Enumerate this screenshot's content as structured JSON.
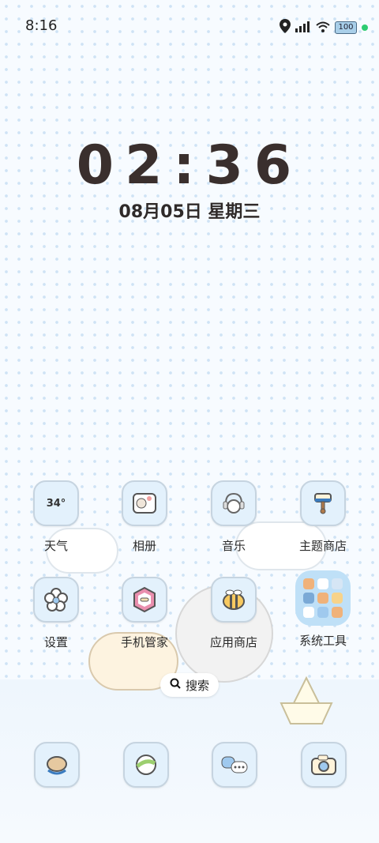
{
  "status_bar": {
    "time": "8:16",
    "battery": "100",
    "icons": [
      "location-icon",
      "signal-icon",
      "wifi-icon",
      "battery-icon",
      "privacy-dot"
    ]
  },
  "clock": {
    "time": "02:36",
    "date": "08月05日 星期三"
  },
  "apps_row1": [
    {
      "label": "天气",
      "icon_text": "34°",
      "icon": "weather-icon"
    },
    {
      "label": "相册",
      "icon": "gallery-icon"
    },
    {
      "label": "音乐",
      "icon": "music-icon"
    },
    {
      "label": "主题商店",
      "icon": "theme-store-icon"
    }
  ],
  "apps_row2": [
    {
      "label": "设置",
      "icon": "settings-icon"
    },
    {
      "label": "手机管家",
      "icon": "phone-manager-icon"
    },
    {
      "label": "应用商店",
      "icon": "app-store-icon"
    },
    {
      "label": "系统工具",
      "icon": "system-tools-folder"
    }
  ],
  "search": {
    "label": "搜索"
  },
  "dock": [
    {
      "icon": "phone-icon"
    },
    {
      "icon": "browser-icon"
    },
    {
      "icon": "messages-icon"
    },
    {
      "icon": "camera-icon"
    }
  ],
  "colors": {
    "icon_bg": "#e3f1fc",
    "clock_text": "#3a2f2d",
    "status_dot": "#2ecc71"
  }
}
